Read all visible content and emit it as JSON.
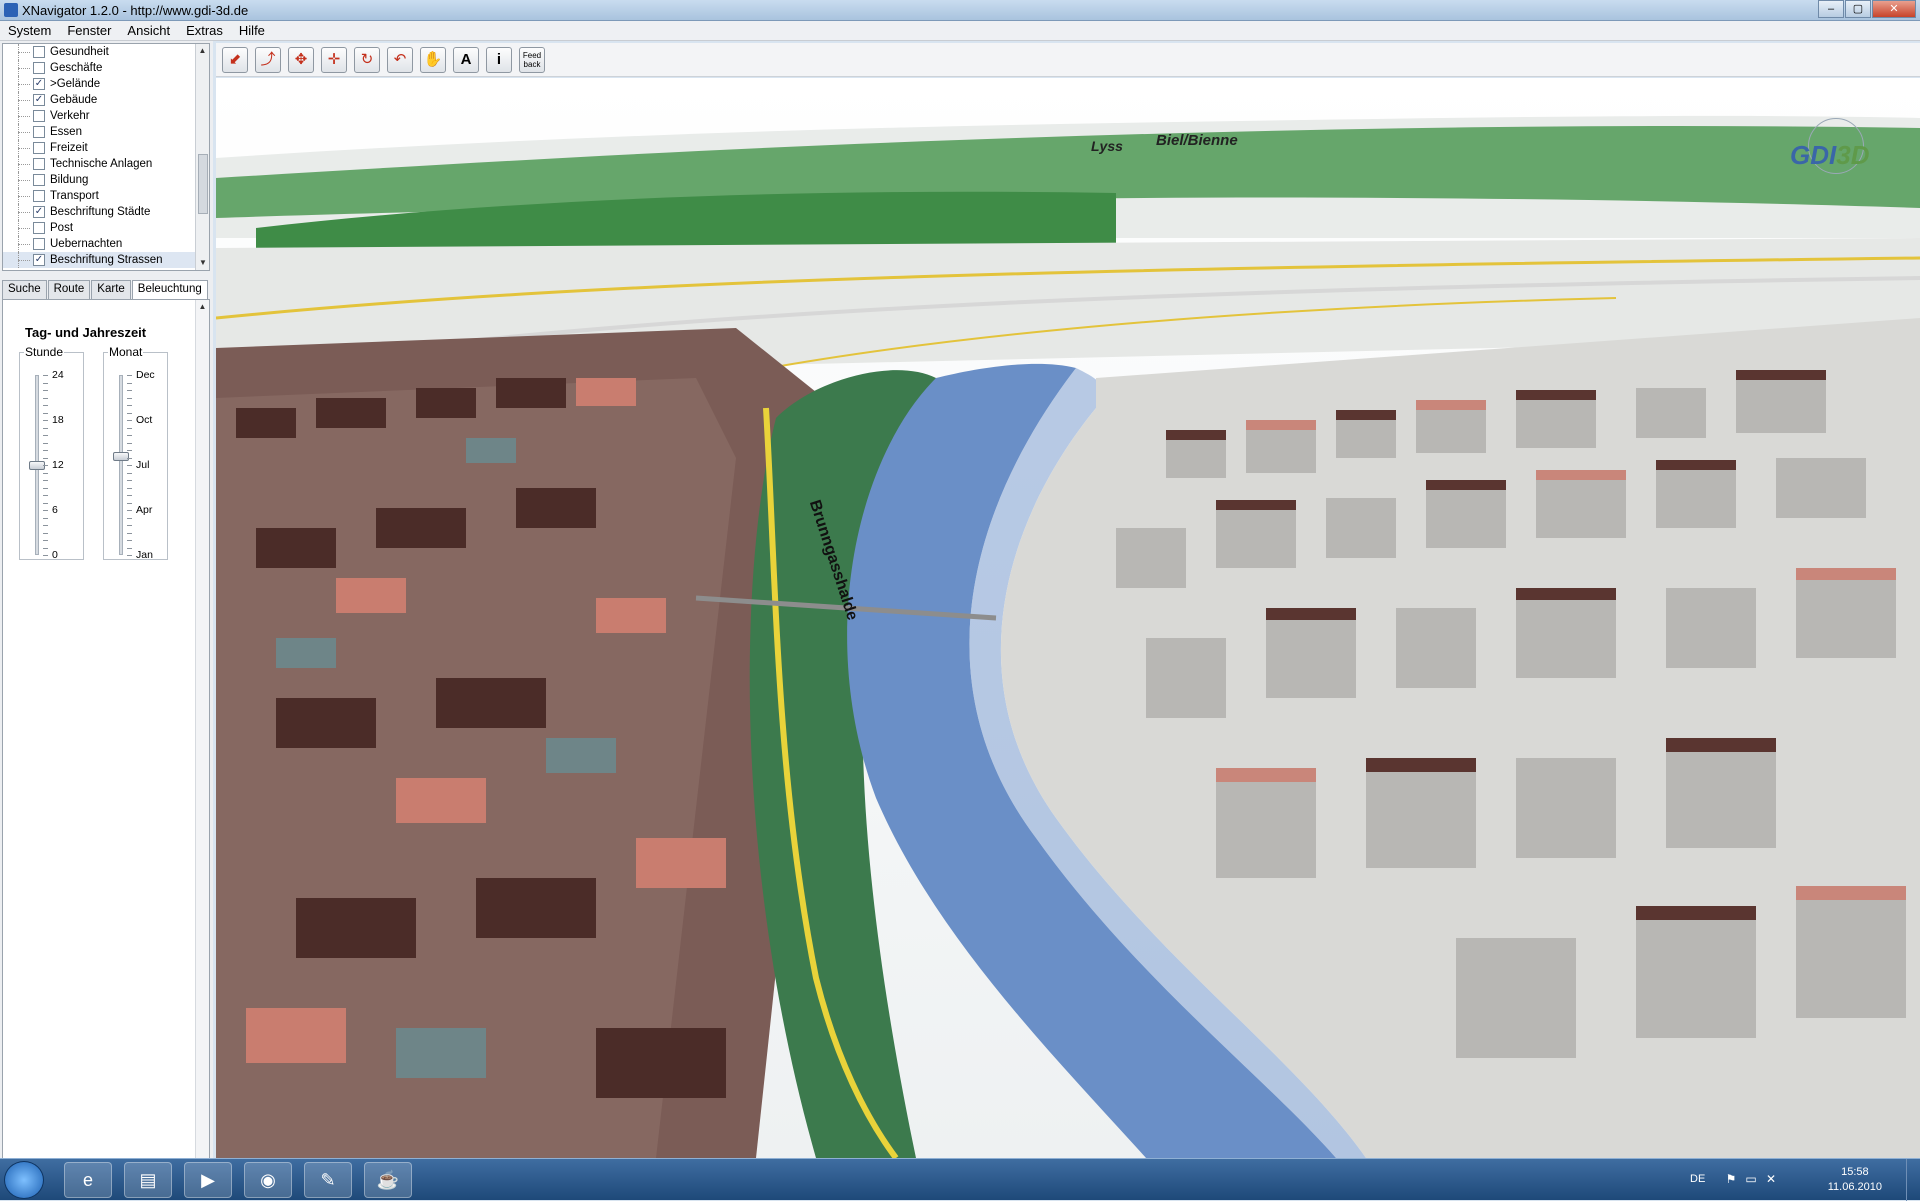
{
  "window": {
    "title": "XNavigator 1.2.0 - http://www.gdi-3d.de",
    "controls": [
      "–",
      "▢",
      "✕"
    ]
  },
  "menu": [
    "System",
    "Fenster",
    "Ansicht",
    "Extras",
    "Hilfe"
  ],
  "layers": [
    {
      "label": "Gesundheit",
      "checked": false
    },
    {
      "label": "Geschäfte",
      "checked": false
    },
    {
      "label": ">Gelände",
      "checked": true
    },
    {
      "label": "Gebäude",
      "checked": true
    },
    {
      "label": "Verkehr",
      "checked": false
    },
    {
      "label": "Essen",
      "checked": false
    },
    {
      "label": "Freizeit",
      "checked": false
    },
    {
      "label": "Technische Anlagen",
      "checked": false
    },
    {
      "label": "Bildung",
      "checked": false
    },
    {
      "label": "Transport",
      "checked": false
    },
    {
      "label": "Beschriftung Städte",
      "checked": true
    },
    {
      "label": "Post",
      "checked": false
    },
    {
      "label": "Uebernachten",
      "checked": false
    },
    {
      "label": "Beschriftung Strassen",
      "checked": true
    }
  ],
  "tabs": [
    "Suche",
    "Route",
    "Karte",
    "Beleuchtung"
  ],
  "active_tab": "Beleuchtung",
  "lighting": {
    "title": "Tag- und Jahreszeit",
    "hour_label": "Stunde",
    "hour_ticks": [
      "24",
      "18",
      "12",
      "6",
      "0"
    ],
    "hour_value": 12,
    "month_label": "Monat",
    "month_ticks": [
      "Dec",
      "Oct",
      "Jul",
      "Apr",
      "Jan"
    ],
    "month_value_fraction": 0.55
  },
  "toolbar": {
    "icons": [
      "rotate-left-icon",
      "tilt-icon",
      "move-vertical-icon",
      "move-horizontal-icon",
      "rotate-circle-icon",
      "undo-icon",
      "hand-pan-icon",
      "label-a-icon",
      "info-icon",
      "feedback-icon"
    ],
    "label_button": "A",
    "info_button": "i",
    "feedback_button": "Feed back"
  },
  "map": {
    "place_labels": [
      "Lyss",
      "Biel/Bienne"
    ],
    "logo": "GDI3D",
    "street_label": "Brunngasshalde"
  },
  "taskbar": {
    "language": "DE",
    "time": "15:58",
    "date": "11.06.2010"
  }
}
